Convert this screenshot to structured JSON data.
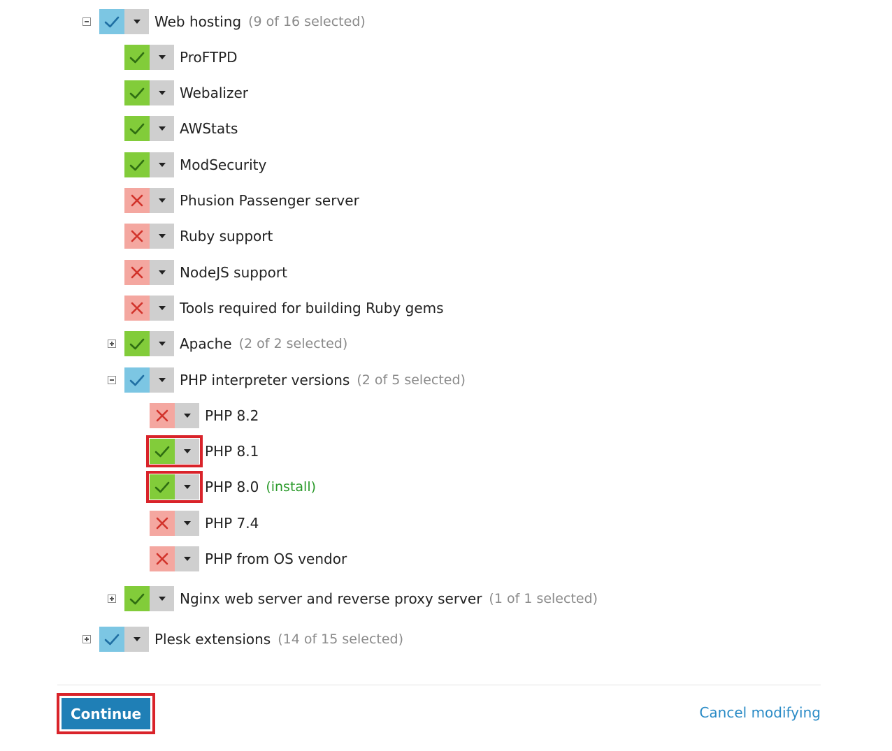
{
  "components": [
    {
      "label": "Web hosting",
      "count": "(9 of 16 selected)",
      "state": "partial",
      "expander": "minus"
    },
    {
      "label": "ProFTPD",
      "state": "on"
    },
    {
      "label": "Webalizer",
      "state": "on"
    },
    {
      "label": "AWStats",
      "state": "on"
    },
    {
      "label": "ModSecurity",
      "state": "on"
    },
    {
      "label": "Phusion Passenger server",
      "state": "off"
    },
    {
      "label": "Ruby support",
      "state": "off"
    },
    {
      "label": "NodeJS support",
      "state": "off"
    },
    {
      "label": "Tools required for building Ruby gems",
      "state": "off"
    },
    {
      "label": "Apache",
      "count": "(2 of 2 selected)",
      "state": "on",
      "expander": "plus"
    },
    {
      "label": "PHP interpreter versions",
      "count": "(2 of 5 selected)",
      "state": "partial",
      "expander": "minus"
    },
    {
      "label": "PHP 8.2",
      "state": "off"
    },
    {
      "label": "PHP 8.1",
      "state": "on",
      "highlighted": true
    },
    {
      "label": "PHP 8.0",
      "note": "(install)",
      "state": "on",
      "highlighted": true
    },
    {
      "label": "PHP 7.4",
      "state": "off"
    },
    {
      "label": "PHP from OS vendor",
      "state": "off"
    },
    {
      "label": "Nginx web server and reverse proxy server",
      "count": "(1 of 1 selected)",
      "state": "on",
      "expander": "plus"
    },
    {
      "label": "Plesk extensions",
      "count": "(14 of 15 selected)",
      "state": "partial",
      "expander": "plus"
    }
  ],
  "footer": {
    "continue_label": "Continue",
    "cancel_label": "Cancel modifying"
  },
  "colors": {
    "partial": "#7cc6e3",
    "on": "#82cc3a",
    "off": "#f4a7a0",
    "dropdown": "#cfcfcf",
    "highlight": "#d9232a",
    "button": "#1f7fb6",
    "link": "#2a8bc6"
  },
  "icons": {
    "partial": "checkmark-icon",
    "on": "checkmark-icon",
    "off": "cross-icon",
    "dropdown": "caret-down-icon",
    "expander_minus": "collapse-icon",
    "expander_plus": "expand-icon"
  }
}
